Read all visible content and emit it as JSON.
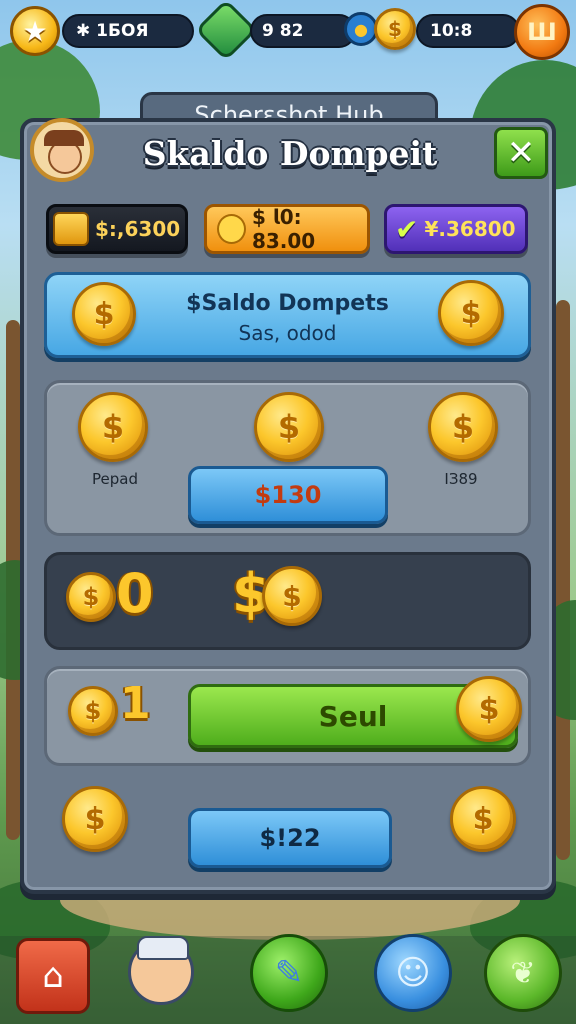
{
  "top_bar": {
    "left_stat": "✱ 1БОЯ",
    "gems_value": "9 82",
    "gold_value": "10:8"
  },
  "panel": {
    "hub_label": "Scherɛshot Hub",
    "title": "Skaldo Dompeit"
  },
  "currencies": [
    {
      "label": "$:,6300"
    },
    {
      "label": "$ 𝗹0: 83.00"
    },
    {
      "label": "¥.36800"
    }
  ],
  "banner": {
    "line1": "$Saldo Dompets",
    "line2": "Sas, odod"
  },
  "section_one": {
    "left_label": "Pepad",
    "right_label": "ІЗ89",
    "button_label": "$130"
  },
  "section_two": {
    "left_amount": "0",
    "right_amount": "$"
  },
  "section_three": {
    "left_amount": "1",
    "button_label": "Seul"
  },
  "footer": {
    "button_label": "$!22"
  },
  "colors": {
    "accent_gold": "#fcc72c",
    "button_blue": "#2f8fd8",
    "button_green": "#4fae1c",
    "close_green": "#3e9b19",
    "gold_pill": "#f7a623",
    "purple_pill": "#6c3fd2",
    "nav_home_red": "#d8432a"
  },
  "icons": [
    "star-icon",
    "gem-icon",
    "gold-coin-icon",
    "shop-icon",
    "close-icon",
    "chest-icon",
    "check-icon",
    "home-icon",
    "hero-avatar-icon",
    "pencil-icon",
    "smile-icon",
    "leaf-icon"
  ]
}
